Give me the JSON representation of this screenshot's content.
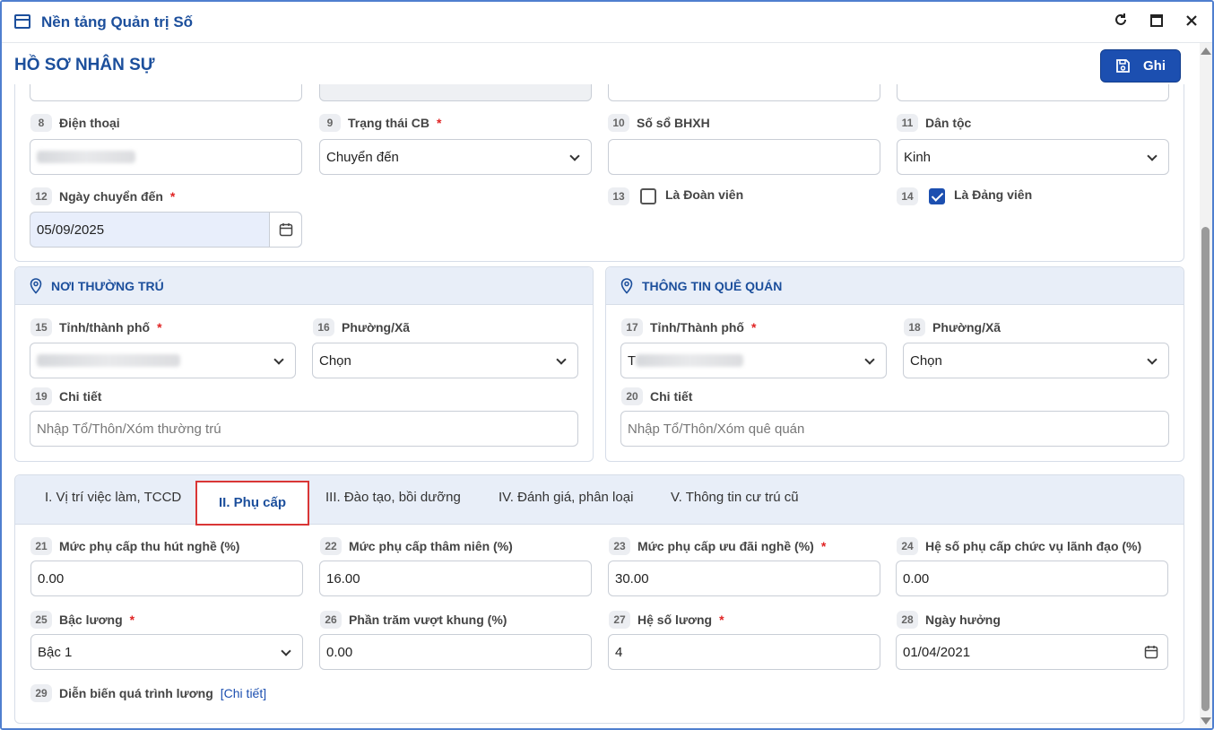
{
  "window": {
    "title": "Nền tảng Quản trị Số",
    "reload_icon": "refresh-icon",
    "maximize_icon": "maximize-icon",
    "close_icon": "close-icon"
  },
  "header": {
    "title": "HỒ SƠ NHÂN SỰ",
    "save_label": "Ghi"
  },
  "personal": {
    "f8_num": "8",
    "f8_label": "Điện thoại",
    "f9_num": "9",
    "f9_label": "Trạng thái CB",
    "f9_value": "Chuyển đến",
    "f10_num": "10",
    "f10_label": "Số sổ BHXH",
    "f10_value": "",
    "f11_num": "11",
    "f11_label": "Dân tộc",
    "f11_value": "Kinh",
    "f12_num": "12",
    "f12_label": "Ngày chuyển đến",
    "f12_value": "05/09/2025",
    "f13_num": "13",
    "f13_label": "Là Đoàn viên",
    "f13_checked": false,
    "f14_num": "14",
    "f14_label": "Là Đảng viên",
    "f14_checked": true,
    "required_mark": "*"
  },
  "residence": {
    "title": "NƠI THƯỜNG TRÚ",
    "f15_num": "15",
    "f15_label": "Tỉnh/thành phố",
    "f16_num": "16",
    "f16_label": "Phường/Xã",
    "f16_value": "Chọn",
    "f19_num": "19",
    "f19_label": "Chi tiết",
    "f19_placeholder": "Nhập Tổ/Thôn/Xóm thường trú"
  },
  "hometown": {
    "title": "THÔNG TIN QUÊ QUÁN",
    "f17_num": "17",
    "f17_label": "Tỉnh/Thành phố",
    "f17_prefix": "T",
    "f18_num": "18",
    "f18_label": "Phường/Xã",
    "f18_value": "Chọn",
    "f20_num": "20",
    "f20_label": "Chi tiết",
    "f20_placeholder": "Nhập Tổ/Thôn/Xóm quê quán"
  },
  "tabs": [
    {
      "label": "I. Vị trí việc làm, TCCD"
    },
    {
      "label": "II. Phụ cấp",
      "active": true
    },
    {
      "label": "III. Đào tạo, bồi dưỡng"
    },
    {
      "label": "IV. Đánh giá, phân loại"
    },
    {
      "label": "V. Thông tin cư trú cũ"
    }
  ],
  "allowance": {
    "f21_num": "21",
    "f21_label": "Mức phụ cấp thu hút nghề (%)",
    "f21_value": "0.00",
    "f22_num": "22",
    "f22_label": "Mức phụ cấp thâm niên (%)",
    "f22_value": "16.00",
    "f23_num": "23",
    "f23_label": "Mức phụ cấp ưu đãi nghề (%)",
    "f23_value": "30.00",
    "f24_num": "24",
    "f24_label": "Hệ số phụ cấp chức vụ lãnh đạo (%)",
    "f24_value": "0.00",
    "f25_num": "25",
    "f25_label": "Bậc lương",
    "f25_value": "Bậc 1",
    "f26_num": "26",
    "f26_label": "Phần trăm vượt khung (%)",
    "f26_value": "0.00",
    "f27_num": "27",
    "f27_label": "Hệ số lương",
    "f27_value": "4",
    "f28_num": "28",
    "f28_label": "Ngày hưởng",
    "f28_value": "01/04/2021",
    "f29_num": "29",
    "f29_label": "Diễn biến quá trình lương",
    "f29_link": "[Chi tiết]"
  }
}
